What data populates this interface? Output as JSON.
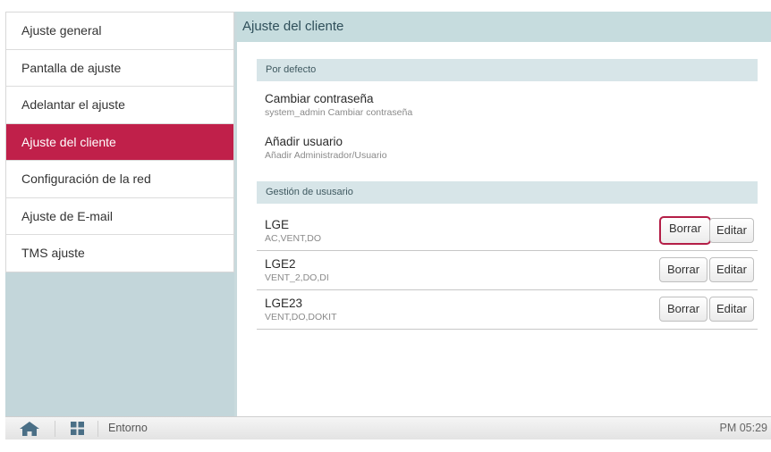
{
  "sidebar": {
    "items": [
      {
        "label": "Ajuste general"
      },
      {
        "label": "Pantalla de ajuste"
      },
      {
        "label": "Adelantar el ajuste"
      },
      {
        "label": "Ajuste del cliente",
        "active": true
      },
      {
        "label": "Configuración de la red"
      },
      {
        "label": "Ajuste de E-mail"
      },
      {
        "label": "TMS ajuste"
      }
    ]
  },
  "content": {
    "title": "Ajuste del cliente",
    "default_section": {
      "label": "Por defecto",
      "rows": [
        {
          "title": "Cambiar contraseña",
          "sub": "system_admin Cambiar contraseña"
        },
        {
          "title": "Añadir usuario",
          "sub": "Añadir Administrador/Usuario"
        }
      ]
    },
    "users_section": {
      "label": "Gestión de ususario",
      "users": [
        {
          "name": "LGE",
          "perms": "AC,VENT,DO"
        },
        {
          "name": "LGE2",
          "perms": "VENT_2,DO,DI"
        },
        {
          "name": "LGE23",
          "perms": "VENT,DO,DOKIT"
        }
      ],
      "delete_label": "Borrar",
      "edit_label": "Editar"
    }
  },
  "bottombar": {
    "home_icon": "home-icon",
    "grid_icon": "grid-icon",
    "label": "Entorno",
    "time": "PM 05:29"
  },
  "colors": {
    "accent": "#c0204a",
    "header_bg": "#c6dcde",
    "section_bg": "#d7e5e8"
  }
}
